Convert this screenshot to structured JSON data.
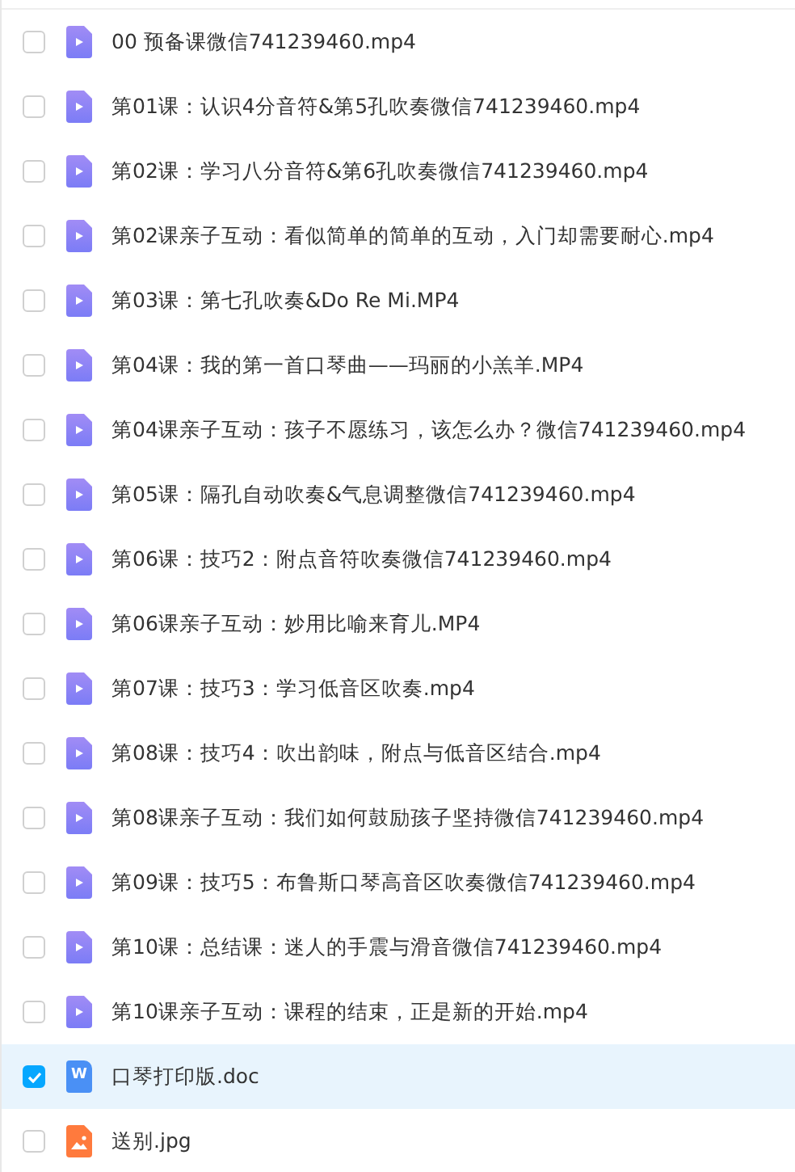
{
  "files": [
    {
      "name": "00 预备课微信741239460.mp4",
      "kind": "video",
      "selected": false
    },
    {
      "name": "第01课：认识4分音符&第5孔吹奏微信741239460.mp4",
      "kind": "video",
      "selected": false
    },
    {
      "name": "第02课：学习八分音符&第6孔吹奏微信741239460.mp4",
      "kind": "video",
      "selected": false
    },
    {
      "name": "第02课亲子互动：看似简单的简单的互动，入门却需要耐心.mp4",
      "kind": "video",
      "selected": false
    },
    {
      "name": "第03课：第七孔吹奏&Do Re Mi.MP4",
      "kind": "video",
      "selected": false
    },
    {
      "name": "第04课：我的第一首口琴曲——玛丽的小羔羊.MP4",
      "kind": "video",
      "selected": false
    },
    {
      "name": "第04课亲子互动：孩子不愿练习，该怎么办？微信741239460.mp4",
      "kind": "video",
      "selected": false
    },
    {
      "name": "第05课：隔孔自动吹奏&气息调整微信741239460.mp4",
      "kind": "video",
      "selected": false
    },
    {
      "name": "第06课：技巧2：附点音符吹奏微信741239460.mp4",
      "kind": "video",
      "selected": false
    },
    {
      "name": "第06课亲子互动：妙用比喻来育儿.MP4",
      "kind": "video",
      "selected": false
    },
    {
      "name": "第07课：技巧3：学习低音区吹奏.mp4",
      "kind": "video",
      "selected": false
    },
    {
      "name": "第08课：技巧4：吹出韵味，附点与低音区结合.mp4",
      "kind": "video",
      "selected": false
    },
    {
      "name": "第08课亲子互动：我们如何鼓励孩子坚持微信741239460.mp4",
      "kind": "video",
      "selected": false
    },
    {
      "name": "第09课：技巧5：布鲁斯口琴高音区吹奏微信741239460.mp4",
      "kind": "video",
      "selected": false
    },
    {
      "name": "第10课：总结课：迷人的手震与滑音微信741239460.mp4",
      "kind": "video",
      "selected": false
    },
    {
      "name": "第10课亲子互动：课程的结束，正是新的开始.mp4",
      "kind": "video",
      "selected": false
    },
    {
      "name": "口琴打印版.doc",
      "kind": "doc",
      "icon_letter": "W",
      "selected": true
    },
    {
      "name": "送别.jpg",
      "kind": "image",
      "selected": false
    }
  ]
}
